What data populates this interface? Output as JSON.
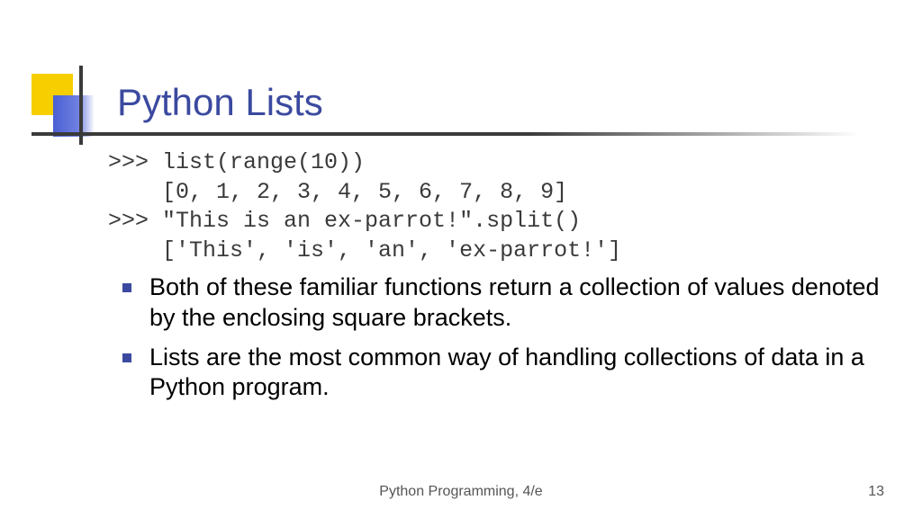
{
  "title": "Python Lists",
  "code": {
    "line1": ">>> list(range(10))",
    "line2": "    [0, 1, 2, 3, 4, 5, 6, 7, 8, 9]",
    "line3": ">>> \"This is an ex-parrot!\".split()",
    "line4": "    ['This', 'is', 'an', 'ex-parrot!']"
  },
  "bullets": {
    "b1": "Both of these familiar functions return a collection of values denoted by the enclosing square brackets.",
    "b2": "Lists are the most common way of handling collections of data in a Python program."
  },
  "footer": "Python Programming, 4/e",
  "pagenum": "13"
}
